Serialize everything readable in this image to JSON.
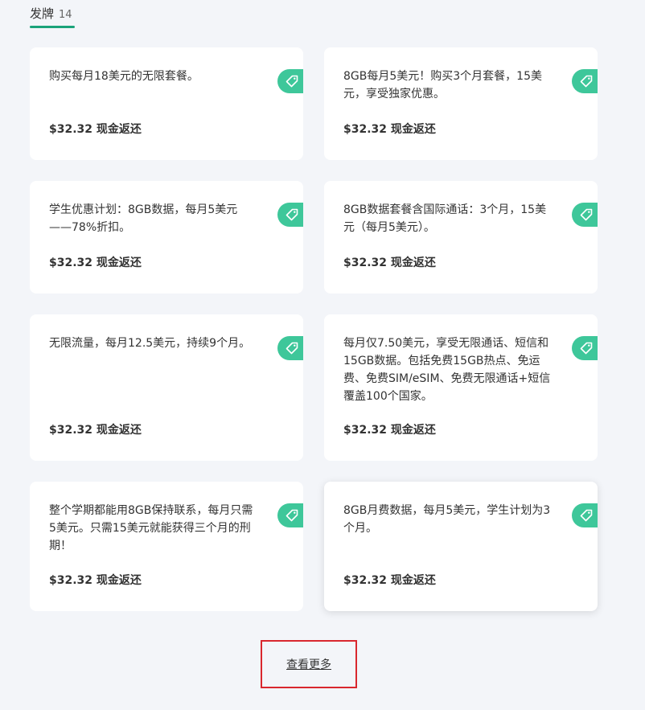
{
  "tabs": {
    "active": {
      "label": "发牌",
      "count": "14"
    }
  },
  "accent_color": "#1aa37a",
  "badge_color": "#3ec79a",
  "cards": [
    {
      "text": "购买每月18美元的无限套餐。",
      "cashback": "$32.32 现金返还",
      "icon": "tag-icon"
    },
    {
      "text": "8GB每月5美元！购买3个月套餐，15美元，享受独家优惠。",
      "cashback": "$32.32 现金返还",
      "icon": "tag-icon"
    },
    {
      "text": "学生优惠计划：8GB数据，每月5美元——78%折扣。",
      "cashback": "$32.32 现金返还",
      "icon": "tag-icon"
    },
    {
      "text": "8GB数据套餐含国际通话：3个月，15美元（每月5美元）。",
      "cashback": "$32.32 现金返还",
      "icon": "tag-icon"
    },
    {
      "text": "无限流量，每月12.5美元，持续9个月。",
      "cashback": "$32.32 现金返还",
      "icon": "tag-icon"
    },
    {
      "text": "每月仅7.50美元，享受无限通话、短信和15GB数据。包括免费15GB热点、免运费、免费SIM/eSIM、免费无限通话+短信覆盖100个国家。",
      "cashback": "$32.32 现金返还",
      "icon": "tag-icon"
    },
    {
      "text": "整个学期都能用8GB保持联系，每月只需5美元。只需15美元就能获得三个月的刑期！",
      "cashback": "$32.32 现金返还",
      "icon": "tag-icon"
    },
    {
      "text": "8GB月费数据，每月5美元，学生计划为3个月。",
      "cashback": "$32.32 现金返还",
      "icon": "tag-icon"
    }
  ],
  "load_more": {
    "label": "查看更多"
  }
}
